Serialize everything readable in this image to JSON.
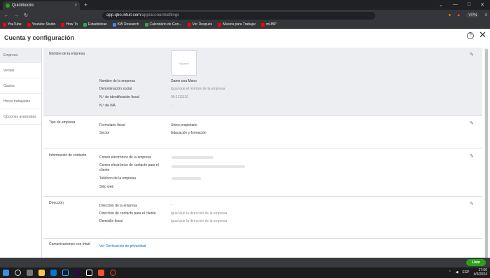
{
  "browser": {
    "tab_title": "Quickbooks",
    "tab_close": "×",
    "new_tab": "+",
    "window_controls": [
      "⌄",
      "—",
      "□",
      "✕"
    ],
    "nav": {
      "back": "←",
      "forward": "→",
      "reload": "↻"
    },
    "url_host": "app.qbo.intuit.com",
    "url_path": "/app/accountsettings",
    "vpn_label": "VPN",
    "bookmarks": [
      {
        "label": "YouTube",
        "color": "#ff0000"
      },
      {
        "label": "Youtube Studio",
        "color": "#ff0000"
      },
      {
        "label": "How To",
        "color": "#ff0000"
      },
      {
        "label": "Estadisticas",
        "color": "#34a853"
      },
      {
        "label": "KW Research",
        "color": "#4285f4"
      },
      {
        "label": "Calendario de Gon...",
        "color": "#34a853"
      },
      {
        "label": "Ver Después",
        "color": "#ff0000"
      },
      {
        "label": "Musica para Trabajar",
        "color": "#ff0000"
      },
      {
        "label": "mUBP",
        "color": "#ff0000"
      }
    ]
  },
  "page": {
    "title": "Cuenta y configuración",
    "help_icon": "?",
    "close_icon": "✕",
    "pencil_icon": "✎",
    "done_button": "Listo"
  },
  "sidebar": {
    "items": [
      {
        "label": "Empresa",
        "active": true
      },
      {
        "label": "Ventas",
        "active": false
      },
      {
        "label": "Gastos",
        "active": false
      },
      {
        "label": "Horas trabajadas",
        "active": false
      },
      {
        "label": "Opciones avanzadas",
        "active": false
      }
    ]
  },
  "sections": {
    "company_name": {
      "title": "Nombre de la empresa",
      "logo_placeholder": "logotipo",
      "rows": [
        {
          "label": "Nombre de la empresa",
          "value": "Dame una Mano"
        },
        {
          "label": "Denominación social",
          "value": "Igual que el nombre de la empresa"
        },
        {
          "label": "N.º de identificación fiscal",
          "value": "99-1111110"
        },
        {
          "label": "N.º de IVA",
          "value": "-"
        }
      ]
    },
    "company_type": {
      "title": "Tipo de empresa",
      "rows": [
        {
          "label": "Formulario fiscal",
          "value": "Único propietario"
        },
        {
          "label": "Sector",
          "value": "Educación y formación"
        }
      ]
    },
    "contact": {
      "title": "Información de contacto",
      "rows": [
        {
          "label": "Correo electrónico de la empresa"
        },
        {
          "label": "Correo electrónico de contacto para el cliente"
        },
        {
          "label": "Teléfono de la empresa"
        },
        {
          "label": "Sitio web"
        }
      ]
    },
    "address": {
      "title": "Dirección",
      "rows": [
        {
          "label": "Dirección de la empresa",
          "value": "-"
        },
        {
          "label": "Dirección de contacto para el cliente",
          "value": "Igual que la dirección de la empresa"
        },
        {
          "label": "Domicilio fiscal",
          "value": "Igual que la dirección de la empresa"
        }
      ]
    },
    "communications": {
      "title": "Comunicaciones con Intuit",
      "link": "Ver Declaración de privacidad"
    }
  },
  "taskbar": {
    "lang": "ESP",
    "time": "17:06",
    "date": "4/3/2024"
  }
}
